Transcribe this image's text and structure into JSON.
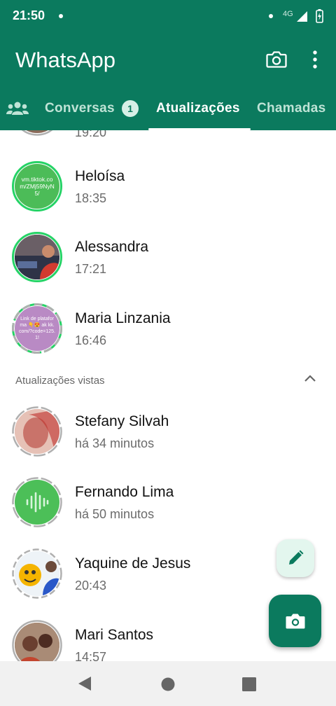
{
  "status_bar": {
    "time": "21:50",
    "network": "4G"
  },
  "app": {
    "title": "WhatsApp"
  },
  "header_icons": [
    "camera-icon",
    "more-options-icon"
  ],
  "tabs": {
    "communities_icon": "communities-icon",
    "conversas": "Conversas",
    "conversas_badge": "1",
    "atualizacoes": "Atualizações",
    "chamadas": "Chamadas",
    "active": "Atualizações"
  },
  "partial_row": {
    "time": "19:20"
  },
  "recent": [
    {
      "name": "Heloísa",
      "time": "18:35",
      "avatar_text": "vm.tiktok.com/ZMj59NyN5/"
    },
    {
      "name": "Alessandra",
      "time": "17:21"
    },
    {
      "name": "Maria Linzania",
      "time": "16:46",
      "avatar_text": "Link de plataforma 👇😍 ak kk.com/?code=125.1!"
    }
  ],
  "viewed_section": {
    "label": "Atualizações vistas",
    "icon": "chevron-up-icon"
  },
  "viewed": [
    {
      "name": "Stefany Silvah",
      "time": "há 34 minutos"
    },
    {
      "name": "Fernando Lima",
      "time": "há 50 minutos",
      "icon": "audio-wave-icon"
    },
    {
      "name": "Yaquine de Jesus",
      "time": "20:43"
    },
    {
      "name": "Mari Santos",
      "time": "14:57"
    }
  ],
  "colors": {
    "brand": "#0b7a5e",
    "ring_unviewed": "#25d366",
    "ring_viewed": "#b0b0b0"
  },
  "fabs": [
    "pencil-icon",
    "camera-icon"
  ],
  "nav": [
    "back-icon",
    "home-icon",
    "recents-icon"
  ]
}
